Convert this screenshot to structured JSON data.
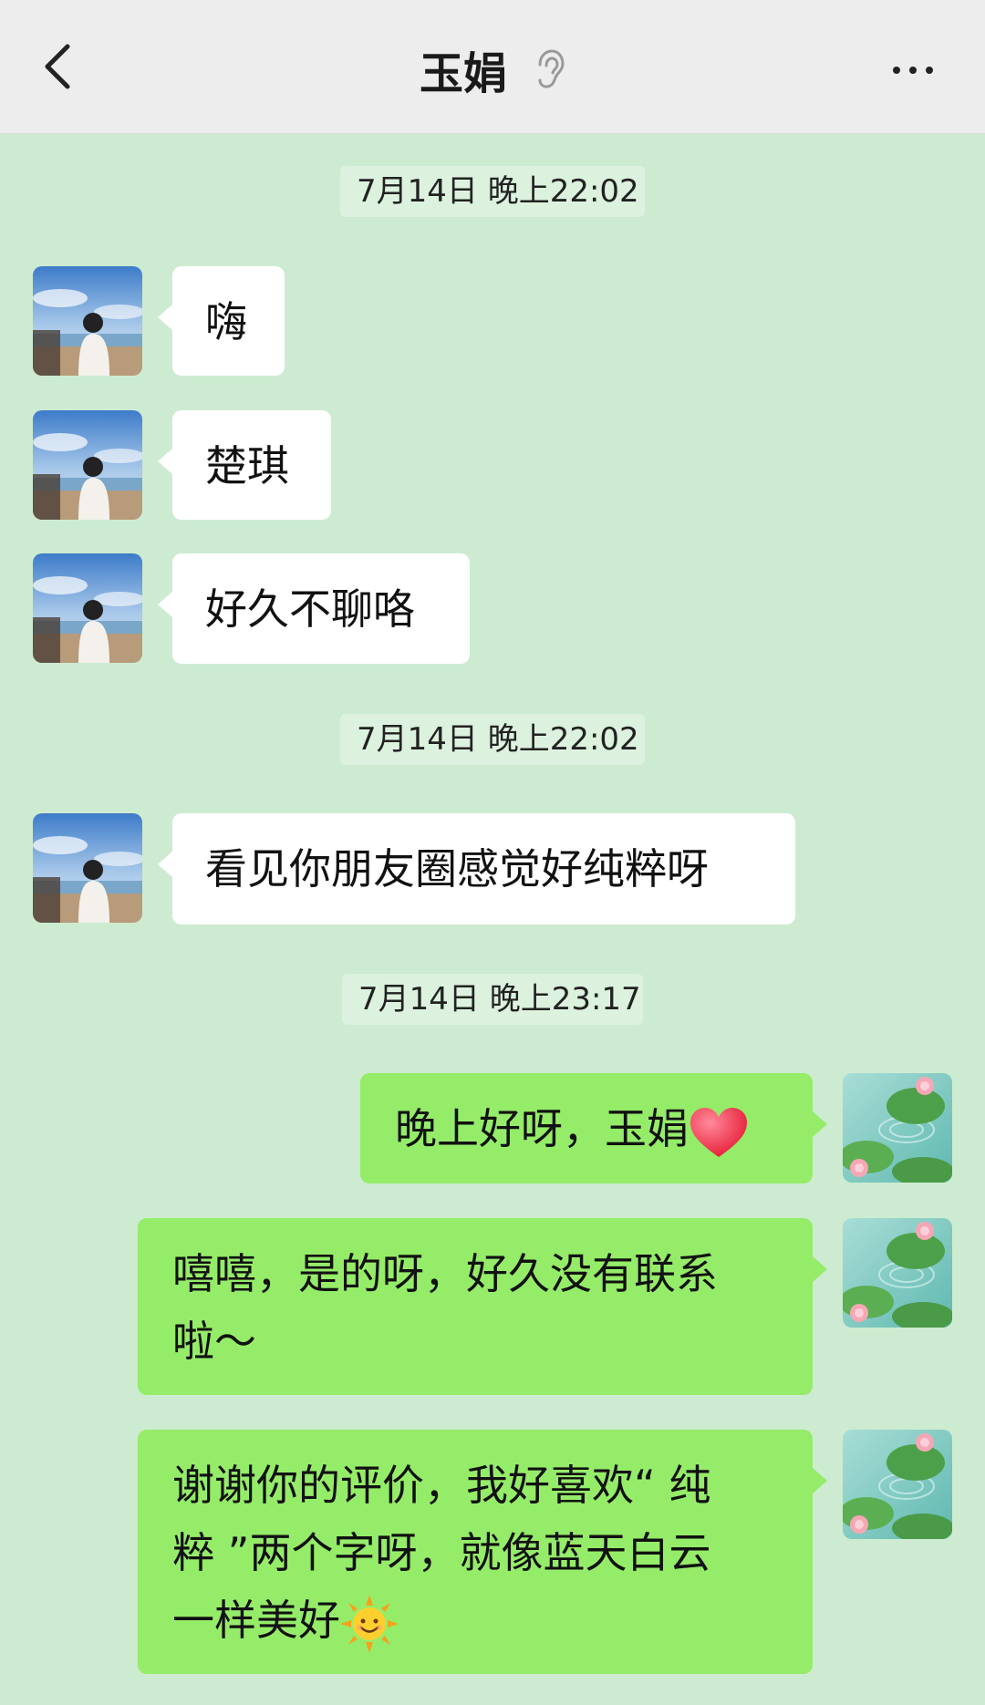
{
  "header": {
    "title": "玉娟",
    "back_icon": "chevron-left-icon",
    "mute_icon": "ear-icon",
    "more_icon": "more-dots-icon"
  },
  "chat": {
    "timestamps": [
      "7月14日 晚上22:02",
      "7月14日 晚上22:02",
      "7月14日 晚上23:17"
    ],
    "incoming": [
      {
        "text": "嗨"
      },
      {
        "text": "楚琪"
      },
      {
        "text": "好久不聊咯"
      },
      {
        "text": "看见你朋友圈感觉好纯粹呀"
      }
    ],
    "outgoing": [
      {
        "text": "晚上好呀，玉娟",
        "emoji": "red-heart-icon"
      },
      {
        "line1": "嘻嘻，是的呀，好久没有联系",
        "line2": "啦～"
      },
      {
        "line1": "谢谢你的评价，我好喜欢“ 纯",
        "line2": "粹 ”两个字呀，就像蓝天白云",
        "line3": "一样美好",
        "emoji": "sun-face-icon"
      }
    ]
  },
  "colors": {
    "chat_background": "#cdebd1",
    "header_background": "#ededed",
    "incoming_bubble": "#ffffff",
    "outgoing_bubble": "#95ec69"
  }
}
